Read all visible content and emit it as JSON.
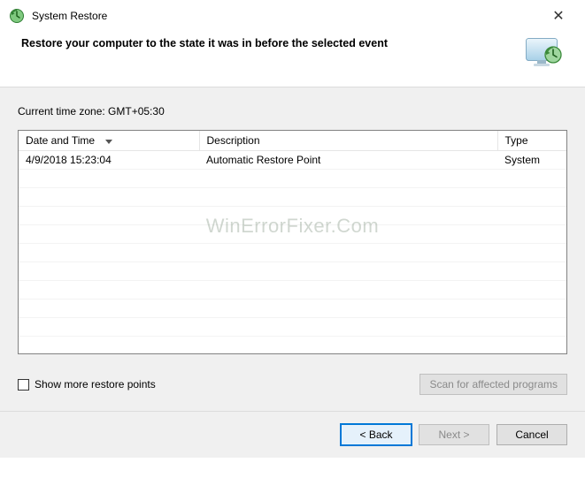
{
  "window": {
    "title": "System Restore"
  },
  "header": {
    "heading": "Restore your computer to the state it was in before the selected event"
  },
  "content": {
    "timezone_label": "Current time zone: GMT+05:30",
    "columns": {
      "datetime": "Date and Time",
      "description": "Description",
      "type": "Type"
    },
    "rows": [
      {
        "datetime": "4/9/2018 15:23:04",
        "description": "Automatic Restore Point",
        "type": "System"
      }
    ],
    "watermark": "WinErrorFixer.Com",
    "show_more_label": "Show more restore points",
    "scan_button": "Scan for affected programs"
  },
  "footer": {
    "back": "< Back",
    "next": "Next >",
    "cancel": "Cancel"
  }
}
